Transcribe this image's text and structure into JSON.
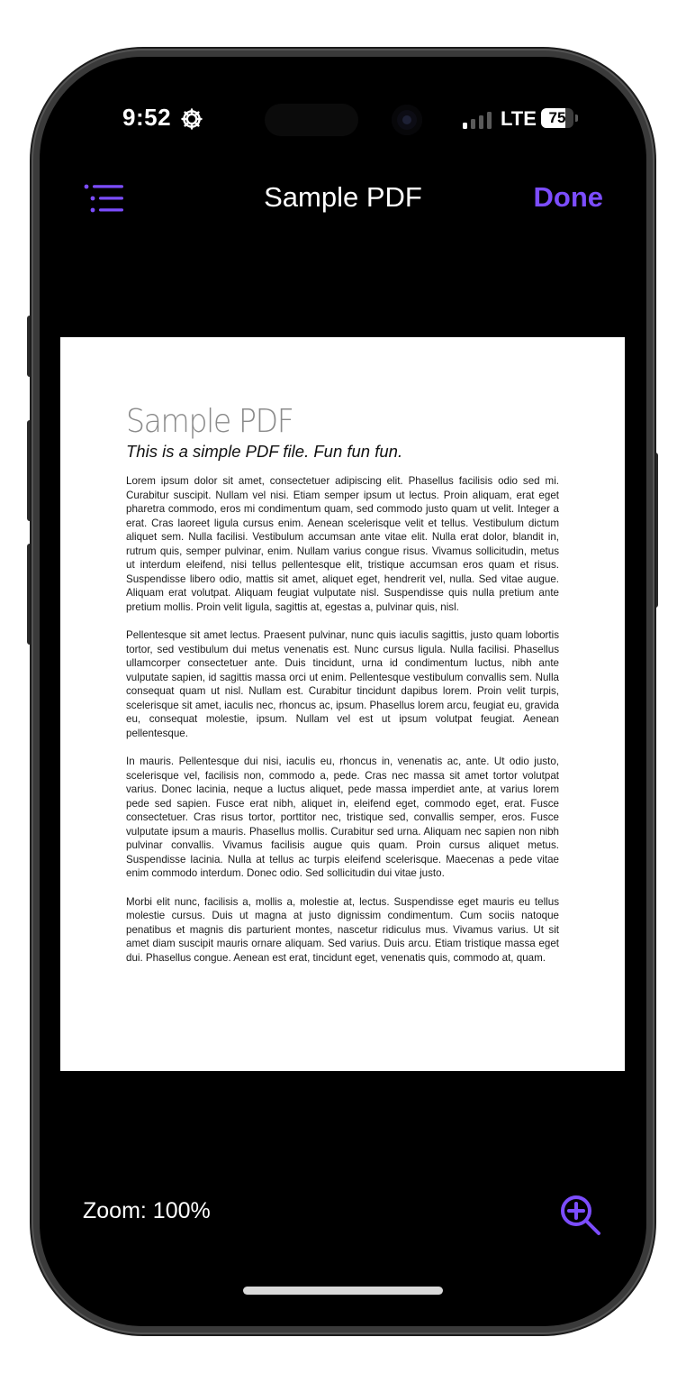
{
  "status_bar": {
    "time": "9:52",
    "network": "LTE",
    "battery": "75",
    "battery_fraction": 0.75
  },
  "nav": {
    "title": "Sample PDF",
    "done_label": "Done"
  },
  "document": {
    "title": "Sample PDF",
    "subtitle": "This is a simple PDF file. Fun fun fun.",
    "paragraphs": [
      "Lorem ipsum dolor sit amet, consectetuer adipiscing elit. Phasellus facilisis odio sed mi. Curabitur suscipit. Nullam vel nisi. Etiam semper ipsum ut lectus. Proin aliquam, erat eget pharetra commodo, eros mi condimentum quam, sed commodo justo quam ut velit. Integer a erat. Cras laoreet ligula cursus enim. Aenean scelerisque velit et tellus. Vestibulum dictum aliquet sem. Nulla facilisi. Vestibulum accumsan ante vitae elit. Nulla erat dolor, blandit in, rutrum quis, semper pulvinar, enim. Nullam varius congue risus. Vivamus sollicitudin, metus ut interdum eleifend, nisi tellus pellentesque elit, tristique accumsan eros quam et risus. Suspendisse libero odio, mattis sit amet, aliquet eget, hendrerit vel, nulla. Sed vitae augue. Aliquam erat volutpat. Aliquam feugiat vulputate nisl. Suspendisse quis nulla pretium ante pretium mollis. Proin velit ligula, sagittis at, egestas a, pulvinar quis, nisl.",
      "Pellentesque sit amet lectus. Praesent pulvinar, nunc quis iaculis sagittis, justo quam lobortis tortor, sed vestibulum dui metus venenatis est. Nunc cursus ligula. Nulla facilisi. Phasellus ullamcorper consectetuer ante. Duis tincidunt, urna id condimentum luctus, nibh ante vulputate sapien, id sagittis massa orci ut enim. Pellentesque vestibulum convallis sem. Nulla consequat quam ut nisl. Nullam est. Curabitur tincidunt dapibus lorem. Proin velit turpis, scelerisque sit amet, iaculis nec, rhoncus ac, ipsum. Phasellus lorem arcu, feugiat eu, gravida eu, consequat molestie, ipsum. Nullam vel est ut ipsum volutpat feugiat. Aenean pellentesque.",
      "In mauris. Pellentesque dui nisi, iaculis eu, rhoncus in, venenatis ac, ante. Ut odio justo, scelerisque vel, facilisis non, commodo a, pede. Cras nec massa sit amet tortor volutpat varius. Donec lacinia, neque a luctus aliquet, pede massa imperdiet ante, at varius lorem pede sed sapien. Fusce erat nibh, aliquet in, eleifend eget, commodo eget, erat. Fusce consectetuer. Cras risus tortor, porttitor nec, tristique sed, convallis semper, eros. Fusce vulputate ipsum a mauris. Phasellus mollis. Curabitur sed urna. Aliquam nec sapien non nibh pulvinar convallis. Vivamus facilisis augue quis quam. Proin cursus aliquet metus. Suspendisse lacinia. Nulla at tellus ac turpis eleifend scelerisque. Maecenas a pede vitae enim commodo interdum. Donec odio. Sed sollicitudin dui vitae justo.",
      "Morbi elit nunc, facilisis a, mollis a, molestie at, lectus. Suspendisse eget mauris eu tellus molestie cursus. Duis ut magna at justo dignissim condimentum. Cum sociis natoque penatibus et magnis dis parturient montes, nascetur ridiculus mus. Vivamus varius. Ut sit amet diam suscipit mauris ornare aliquam. Sed varius. Duis arcu. Etiam tristique massa eget dui. Phasellus congue. Aenean est erat, tincidunt eget, venenatis quis, commodo at, quam."
    ]
  },
  "bottom_bar": {
    "zoom_label": "Zoom: 100%"
  },
  "icons": {
    "settings_status": "gear-icon",
    "outline": "list-icon",
    "zoom_in": "zoom-in-icon"
  },
  "colors": {
    "accent": "#7c4dff",
    "background": "#000000",
    "page": "#ffffff"
  }
}
